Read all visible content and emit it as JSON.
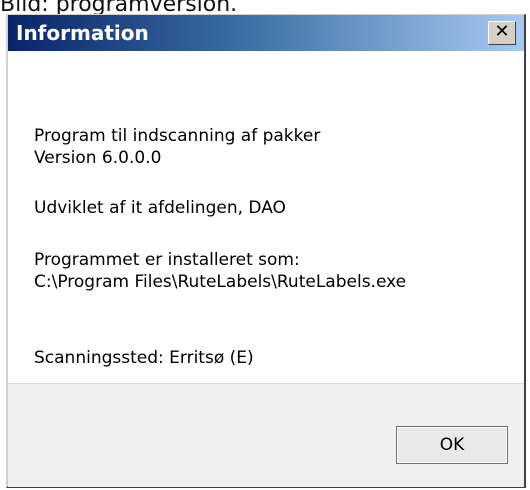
{
  "caption": "Bild: programversion.",
  "window": {
    "title": "Information",
    "close_glyph": "✕"
  },
  "message": {
    "line1": "Program til indscanning af pakker",
    "line2": "Version 6.0.0.0",
    "line3": "Udviklet af it afdelingen, DAO",
    "line4": "Programmet er installeret som:",
    "line5": "C:\\Program Files\\RuteLabels\\RuteLabels.exe",
    "line6": "Scanningssted: Erritsø  (E)"
  },
  "buttons": {
    "ok_label": "OK"
  },
  "colors": {
    "titlebar_start": "#0a246a",
    "titlebar_end": "#a6caf0",
    "footer_bg": "#f0f0f0"
  }
}
